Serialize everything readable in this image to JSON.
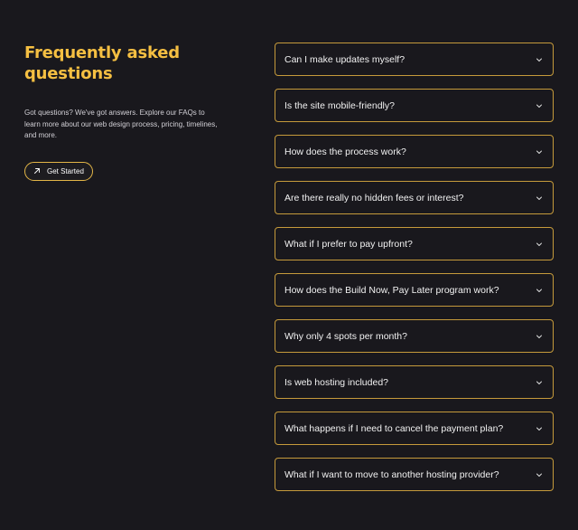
{
  "intro": {
    "title_line1": "Frequently asked",
    "title_line2": "questions",
    "description": "Got questions? We've got answers. Explore our FAQs to learn more about our web design process, pricing, timelines, and more.",
    "cta_label": "Get Started",
    "cta_icon": "arrow-up-right-icon"
  },
  "faq": {
    "items": [
      {
        "question": "Can I make updates myself?"
      },
      {
        "question": "Is the site mobile-friendly?"
      },
      {
        "question": "How does the process work?"
      },
      {
        "question": "Are there really no hidden fees or interest?"
      },
      {
        "question": "What if I prefer to pay upfront?"
      },
      {
        "question": "How does the Build Now, Pay Later program work?"
      },
      {
        "question": "Why only 4 spots per month?"
      },
      {
        "question": "Is web hosting included?"
      },
      {
        "question": "What happens if I need to cancel the payment plan?"
      },
      {
        "question": "What if I want to move to another hosting provider?"
      }
    ],
    "expand_icon": "chevron-down-icon"
  },
  "colors": {
    "background": "#19181d",
    "accent": "#f5bf42",
    "border": "#c59a3b",
    "text": "#f2f2f2"
  }
}
